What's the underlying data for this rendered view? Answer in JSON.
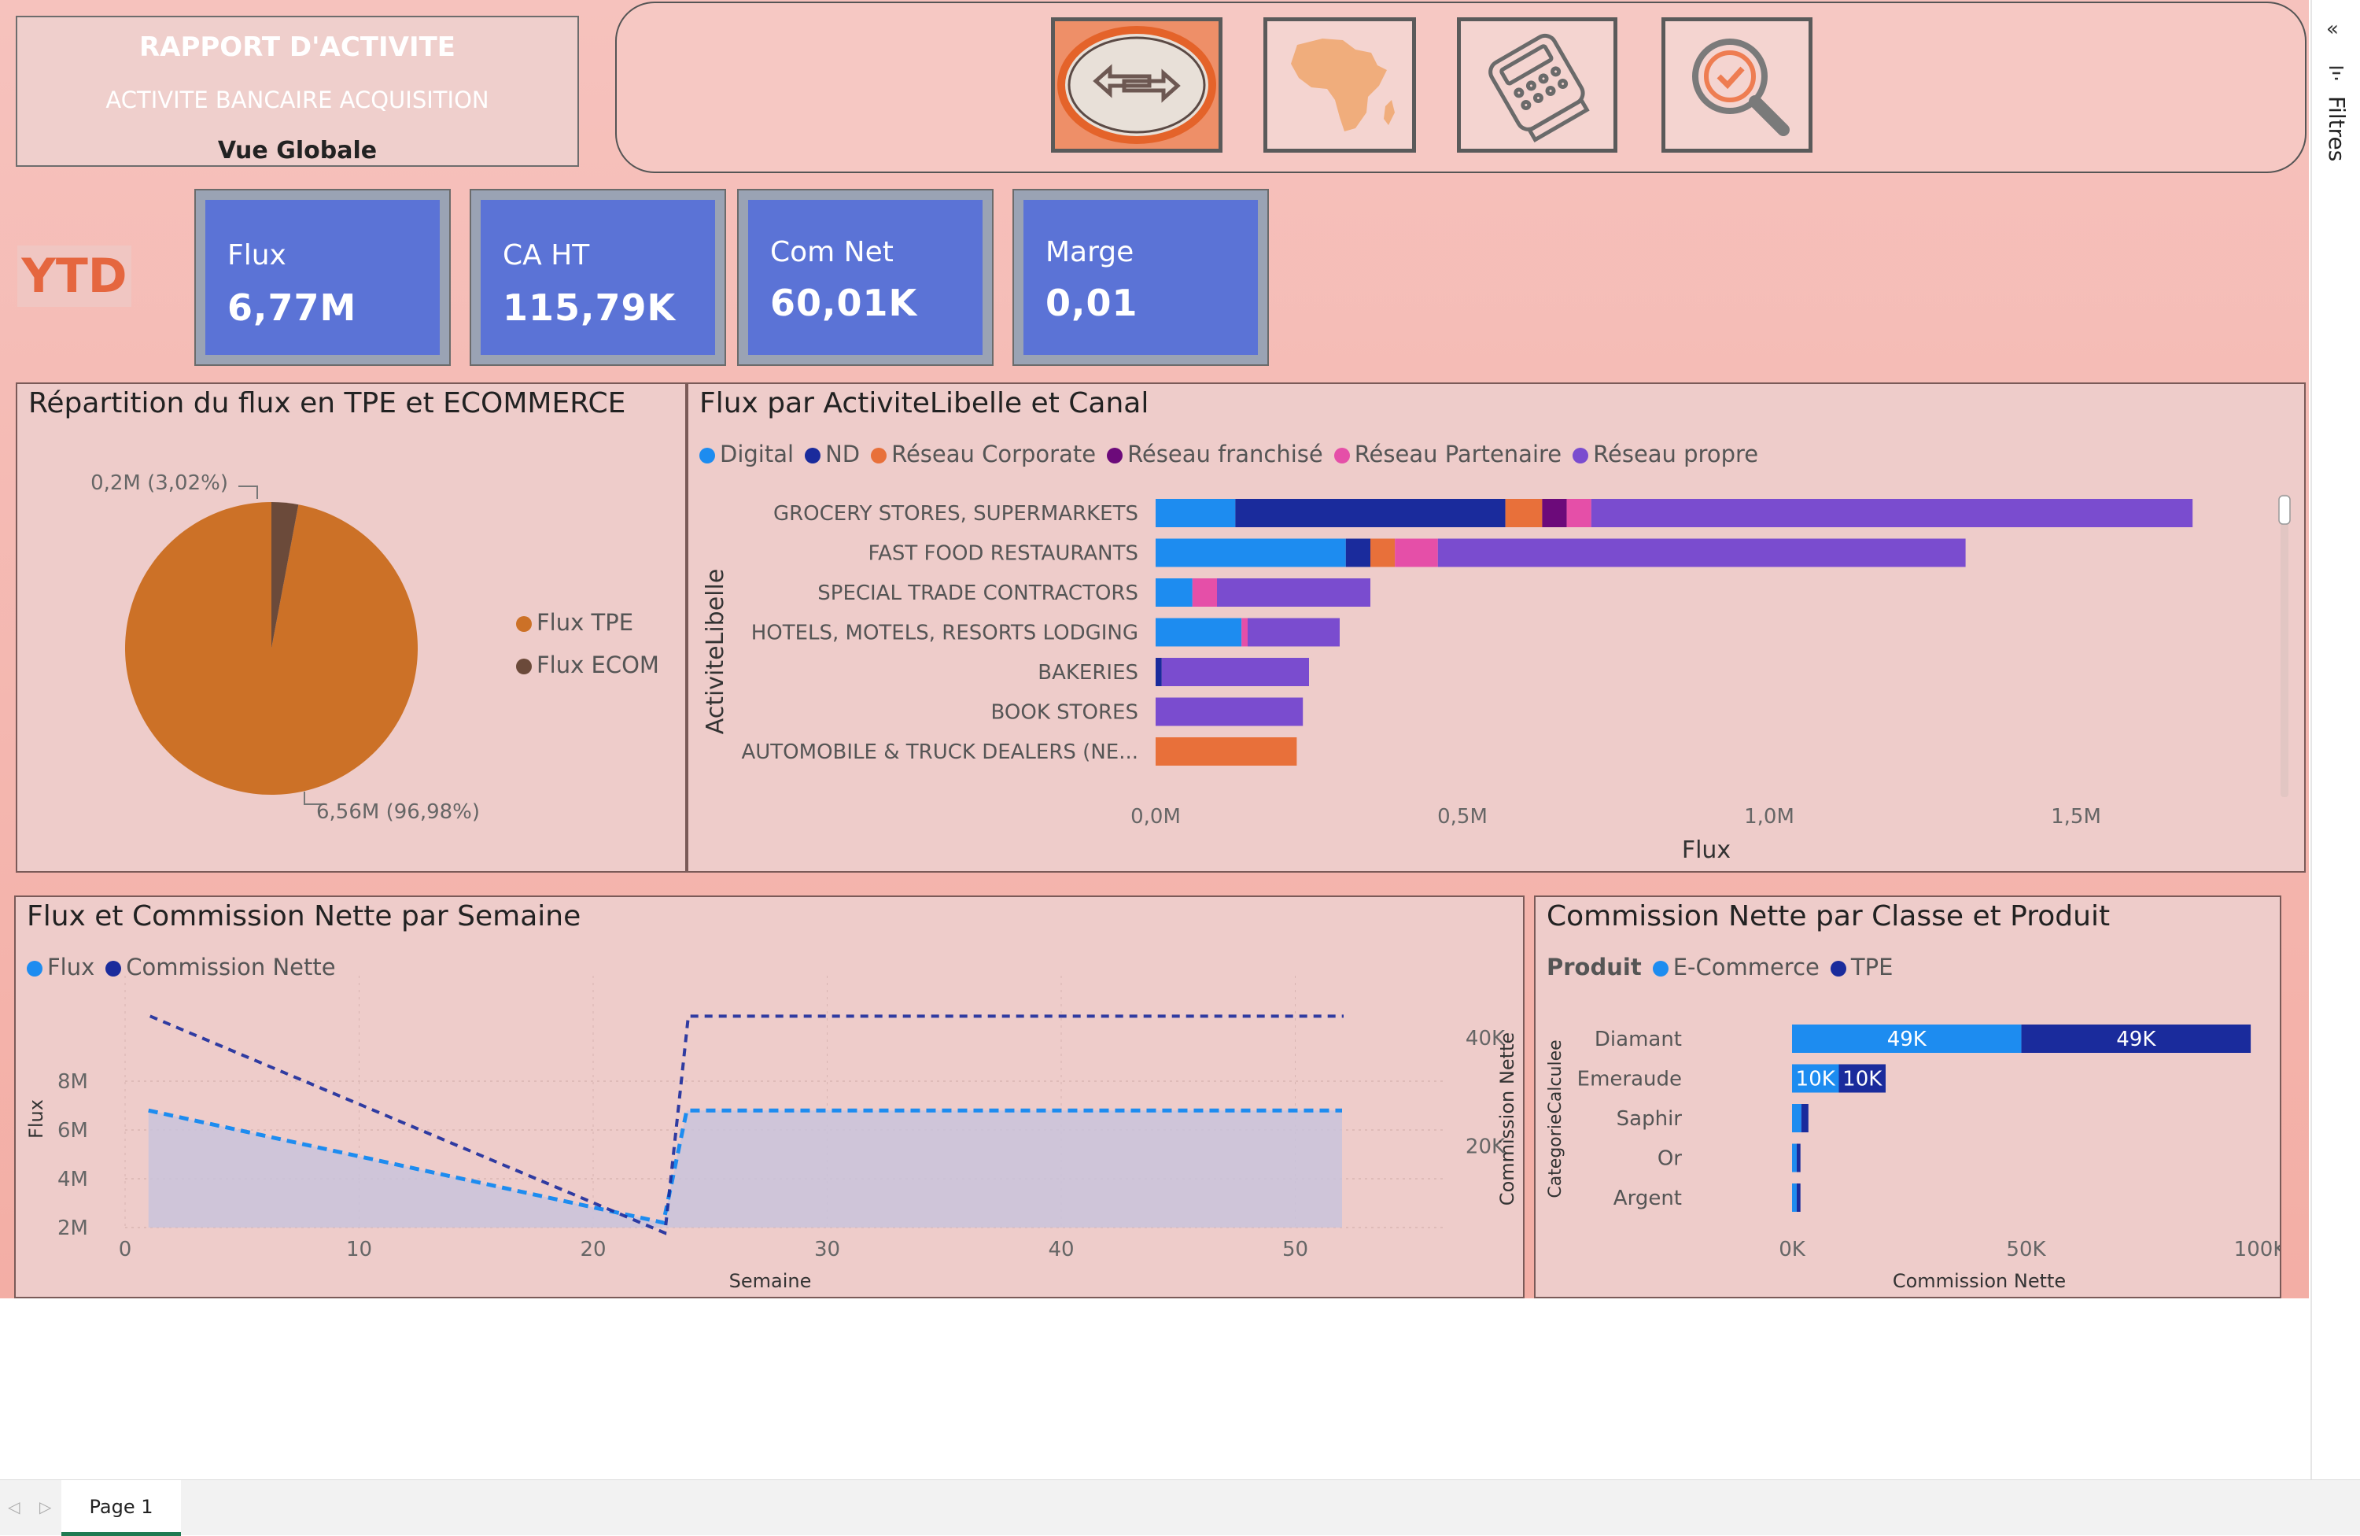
{
  "header": {
    "title": "RAPPORT D'ACTIVITE",
    "subtitle": "ACTIVITE BANCAIRE ACQUISITION",
    "view": "Vue Globale"
  },
  "nav": [
    {
      "icon": "transfer-arrows-icon"
    },
    {
      "icon": "africa-map-icon"
    },
    {
      "icon": "payment-terminal-icon"
    },
    {
      "icon": "magnifier-check-icon"
    }
  ],
  "period": "YTD",
  "kpis": [
    {
      "label": "Flux",
      "value": "6,77M"
    },
    {
      "label": "CA HT",
      "value": "115,79K"
    },
    {
      "label": "Com Net",
      "value": "60,01K"
    },
    {
      "label": "Marge",
      "value": "0,01"
    }
  ],
  "pie": {
    "title": "Répartition du flux en TPE et ECOMMERCE",
    "legend": [
      "Flux TPE",
      "Flux  ECOM"
    ],
    "label_tpe": "6,56M (96,98%)",
    "label_ecom": "0,2M (3,02%)"
  },
  "bar": {
    "title": "Flux par ActiviteLibelle et Canal",
    "legend": [
      "Digital",
      "ND",
      "Réseau Corporate",
      "Réseau franchisé",
      "Réseau Partenaire",
      "Réseau propre"
    ],
    "ylabel": "ActiviteLibelle",
    "xlabel": "Flux",
    "ticks": [
      "0,0M",
      "0,5M",
      "1,0M",
      "1,5M"
    ]
  },
  "line": {
    "title": "Flux et Commission Nette par Semaine",
    "legend": [
      "Flux",
      "Commission Nette"
    ],
    "ylabel_left": "Flux",
    "ylabel_right": "Commission Nette",
    "xlabel": "Semaine",
    "left_ticks": [
      "2M",
      "4M",
      "6M",
      "8M"
    ],
    "right_ticks": [
      "20K",
      "40K"
    ],
    "x_ticks": [
      "0",
      "10",
      "20",
      "30",
      "40",
      "50"
    ]
  },
  "hbar": {
    "title": "Commission Nette par Classe et Produit",
    "legend_title": "Produit",
    "legend": [
      "E-Commerce",
      "TPE"
    ],
    "ylabel": "CategorieCalculee",
    "xlabel": "Commission Nette",
    "ticks": [
      "0K",
      "50K",
      "100K"
    ],
    "data_labels": [
      "49K",
      "49K",
      "10K",
      "10K"
    ]
  },
  "tabs": {
    "page1": "Page 1"
  },
  "filters": {
    "label": "Filtres"
  },
  "colors": {
    "digital": "#1d8cf0",
    "nd": "#1a2b9c",
    "corporate": "#e8703a",
    "franchise": "#6c0a7a",
    "partenaire": "#e54fa8",
    "propre": "#7a4ccf",
    "tpe": "#cc7127",
    "ecom": "#6b4a3a",
    "kpi": "#5b73d6"
  },
  "chart_data": [
    {
      "type": "pie",
      "title": "Répartition du flux en TPE et ECOMMERCE",
      "categories": [
        "Flux TPE",
        "Flux  ECOM"
      ],
      "values": [
        6.56,
        0.2
      ],
      "percent": [
        96.98,
        3.02
      ]
    },
    {
      "type": "bar",
      "orientation": "horizontal",
      "stacked": true,
      "title": "Flux par ActiviteLibelle et Canal",
      "categories": [
        "GROCERY STORES, SUPERMARKETS",
        "FAST FOOD RESTAURANTS",
        "SPECIAL TRADE CONTRACTORS",
        "HOTELS, MOTELS, RESORTS LODGING",
        "BAKERIES",
        "BOOK STORES",
        "AUTOMOBILE & TRUCK DEALERS (NE..."
      ],
      "series": [
        {
          "name": "Digital",
          "values": [
            0.13,
            0.31,
            0.06,
            0.14,
            0.0,
            0.0,
            0.0
          ]
        },
        {
          "name": "ND",
          "values": [
            0.44,
            0.04,
            0.0,
            0.0,
            0.01,
            0.0,
            0.0
          ]
        },
        {
          "name": "Réseau Corporate",
          "values": [
            0.06,
            0.04,
            0.0,
            0.0,
            0.0,
            0.0,
            0.23
          ]
        },
        {
          "name": "Réseau franchisé",
          "values": [
            0.04,
            0.0,
            0.0,
            0.0,
            0.0,
            0.0,
            0.0
          ]
        },
        {
          "name": "Réseau Partenaire",
          "values": [
            0.04,
            0.07,
            0.04,
            0.01,
            0.0,
            0.0,
            0.0
          ]
        },
        {
          "name": "Réseau propre",
          "values": [
            0.98,
            0.86,
            0.25,
            0.15,
            0.24,
            0.24,
            0.0
          ]
        }
      ],
      "xlabel": "Flux",
      "ylabel": "ActiviteLibelle",
      "xlim": [
        0,
        1.8
      ]
    },
    {
      "type": "line",
      "title": "Flux et Commission Nette par Semaine",
      "x": [
        1,
        23,
        24,
        52
      ],
      "series": [
        {
          "name": "Flux",
          "axis": "left",
          "values": [
            6.8,
            2.2,
            6.8,
            6.8
          ]
        },
        {
          "name": "Commission Nette",
          "axis": "right",
          "values": [
            44000,
            4000,
            44000,
            44000
          ]
        }
      ],
      "xlabel": "Semaine",
      "ylabel": "Flux",
      "ylabel_right": "Commission Nette",
      "xlim": [
        0,
        55
      ],
      "ylim": [
        2,
        8
      ],
      "ylim_right": [
        5000,
        50000
      ]
    },
    {
      "type": "bar",
      "orientation": "horizontal",
      "stacked": true,
      "title": "Commission Nette par Classe et Produit",
      "categories": [
        "Diamant",
        "Emeraude",
        "Saphir",
        "Or",
        "Argent"
      ],
      "series": [
        {
          "name": "E-Commerce",
          "values": [
            49,
            10,
            2,
            1,
            1
          ]
        },
        {
          "name": "TPE",
          "values": [
            49,
            10,
            1.5,
            0.8,
            0.8
          ]
        }
      ],
      "xlabel": "Commission Nette",
      "ylabel": "CategorieCalculee",
      "xlim": [
        0,
        100
      ]
    }
  ]
}
